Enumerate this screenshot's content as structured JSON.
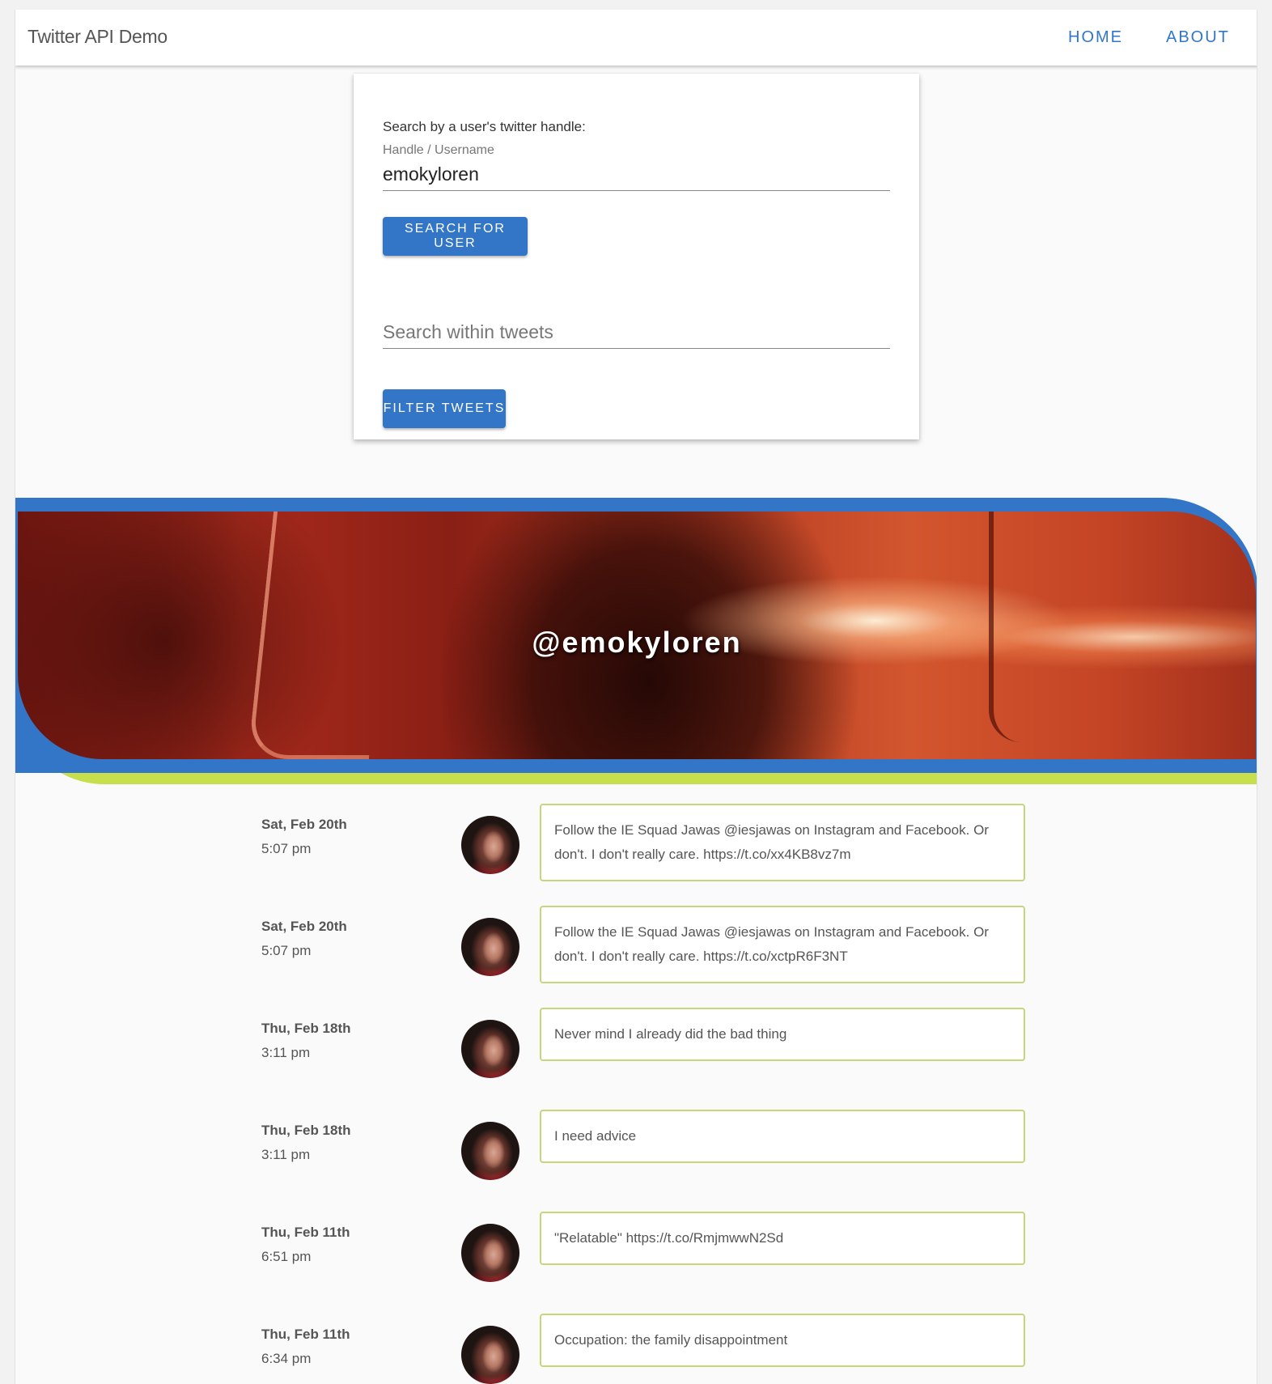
{
  "toolbar": {
    "app_title": "Twitter API Demo",
    "nav": [
      {
        "label": "HOME"
      },
      {
        "label": "ABOUT"
      }
    ]
  },
  "search_card": {
    "label": "Search by a user's twitter handle:",
    "handle_field": {
      "label": "Handle / Username",
      "value": "emokyloren"
    },
    "search_button": "SEARCH FOR USER",
    "filter_field": {
      "placeholder": "Search within tweets",
      "value": ""
    },
    "filter_button": "FILTER TWEETS"
  },
  "banner": {
    "handle": "@emokyloren"
  },
  "colors": {
    "primary": "#3376c7",
    "accent_green": "#c7df4c",
    "tweet_border": "#c4d77a"
  },
  "tweets": [
    {
      "date": "Sat, Feb 20th",
      "time": "5:07 pm",
      "text": "Follow the IE Squad Jawas @iesjawas on Instagram and Facebook. Or don't. I don't really care. https://t.co/xx4KB8vz7m"
    },
    {
      "date": "Sat, Feb 20th",
      "time": "5:07 pm",
      "text": "Follow the IE Squad Jawas @iesjawas on Instagram and Facebook. Or don't. I don't really care. https://t.co/xctpR6F3NT"
    },
    {
      "date": "Thu, Feb 18th",
      "time": "3:11 pm",
      "text": "Never mind I already did the bad thing"
    },
    {
      "date": "Thu, Feb 18th",
      "time": "3:11 pm",
      "text": "I need advice"
    },
    {
      "date": "Thu, Feb 11th",
      "time": "6:51 pm",
      "text": "\"Relatable\" https://t.co/RmjmwwN2Sd"
    },
    {
      "date": "Thu, Feb 11th",
      "time": "6:34 pm",
      "text": "Occupation: the family disappointment"
    }
  ]
}
